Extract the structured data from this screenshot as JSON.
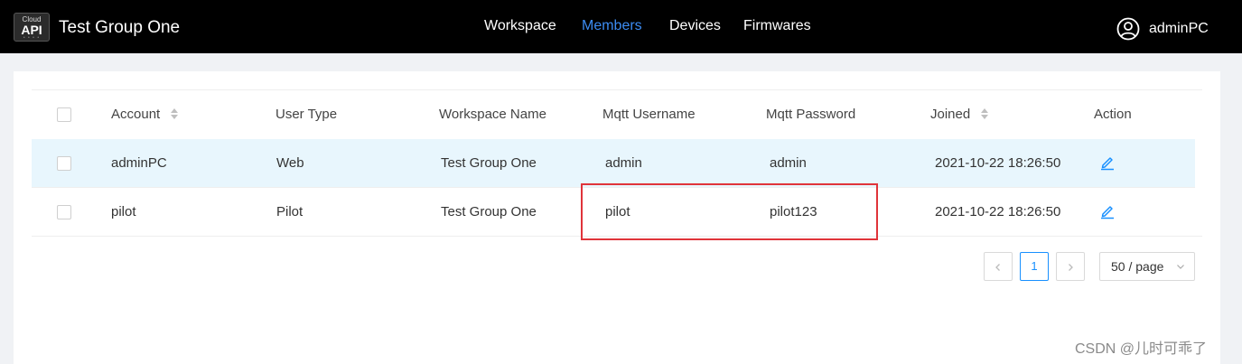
{
  "header": {
    "logo_top": "Cloud",
    "logo_main": "API",
    "group_title": "Test Group One",
    "nav": [
      {
        "label": "Workspace",
        "active": false
      },
      {
        "label": "Members",
        "active": true
      },
      {
        "label": "Devices",
        "active": false
      },
      {
        "label": "Firmwares",
        "active": false
      }
    ],
    "user_name": "adminPC",
    "user_icon": "user-circle-icon"
  },
  "table": {
    "columns": [
      "Account",
      "User Type",
      "Workspace Name",
      "Mqtt Username",
      "Mqtt Password",
      "Joined",
      "Action"
    ],
    "sortable_columns": [
      "Account",
      "Joined"
    ],
    "rows": [
      {
        "account": "adminPC",
        "user_type": "Web",
        "workspace_name": "Test Group One",
        "mqtt_username": "admin",
        "mqtt_password": "admin",
        "joined": "2021-10-22 18:26:50",
        "action_icon": "edit-icon"
      },
      {
        "account": "pilot",
        "user_type": "Pilot",
        "workspace_name": "Test Group One",
        "mqtt_username": "pilot",
        "mqtt_password": "pilot123",
        "joined": "2021-10-22 18:26:50",
        "action_icon": "edit-icon"
      }
    ]
  },
  "pagination": {
    "current_page": "1",
    "page_size": "50 / page"
  },
  "watermark": "CSDN @儿时可乖了",
  "colors": {
    "header_bg": "#000000",
    "active_nav": "#3c8cf3",
    "row_highlight": "#e8f6fd",
    "annotation_box": "#e0343a",
    "link_blue": "#1890ff"
  }
}
